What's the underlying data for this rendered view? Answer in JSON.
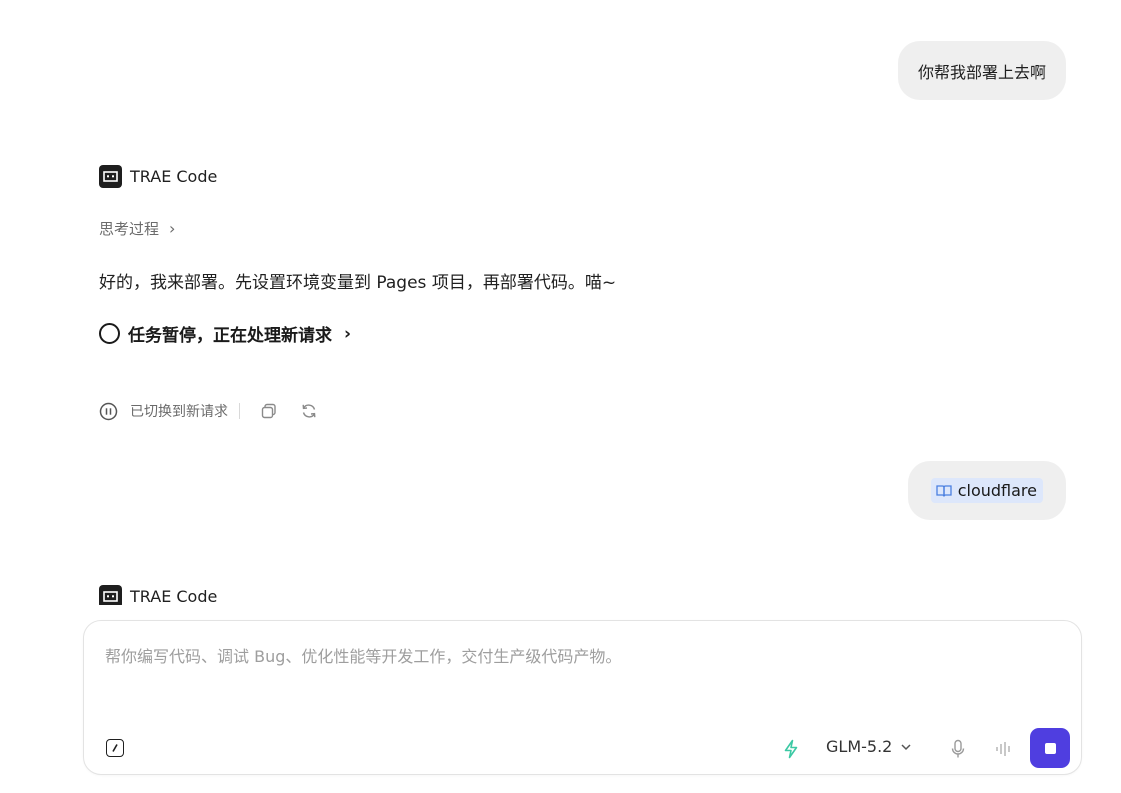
{
  "conversation": {
    "user_message_1": "你帮我部署上去啊",
    "agent_1": {
      "name": "TRAE Code",
      "thinking_label": "思考过程",
      "reply": "好的，我来部署。先设置环境变量到 Pages 项目，再部署代码。喵~",
      "task_status": "任务暂停，正在处理新请求",
      "status_text": "已切换到新请求"
    },
    "user_message_2": {
      "attachment_label": "cloudflare"
    },
    "agent_2": {
      "name": "TRAE Code"
    }
  },
  "composer": {
    "placeholder": "帮你编写代码、调试 Bug、优化性能等开发工作，交付生产级代码产物。",
    "value": "",
    "model_label": "GLM-5.2"
  },
  "colors": {
    "accent": "#4f3ee0",
    "bubble_bg": "#efefef",
    "chip_bg": "#dde7fb",
    "bolt": "#3cc9a4"
  },
  "icons": [
    "trae-logo-icon",
    "chevron-right-icon",
    "circle-icon",
    "pause-circle-icon",
    "copy-icon",
    "refresh-icon",
    "book-icon",
    "slash-command-icon",
    "bolt-icon",
    "chevron-down-icon",
    "microphone-icon",
    "waveform-icon",
    "stop-icon"
  ]
}
